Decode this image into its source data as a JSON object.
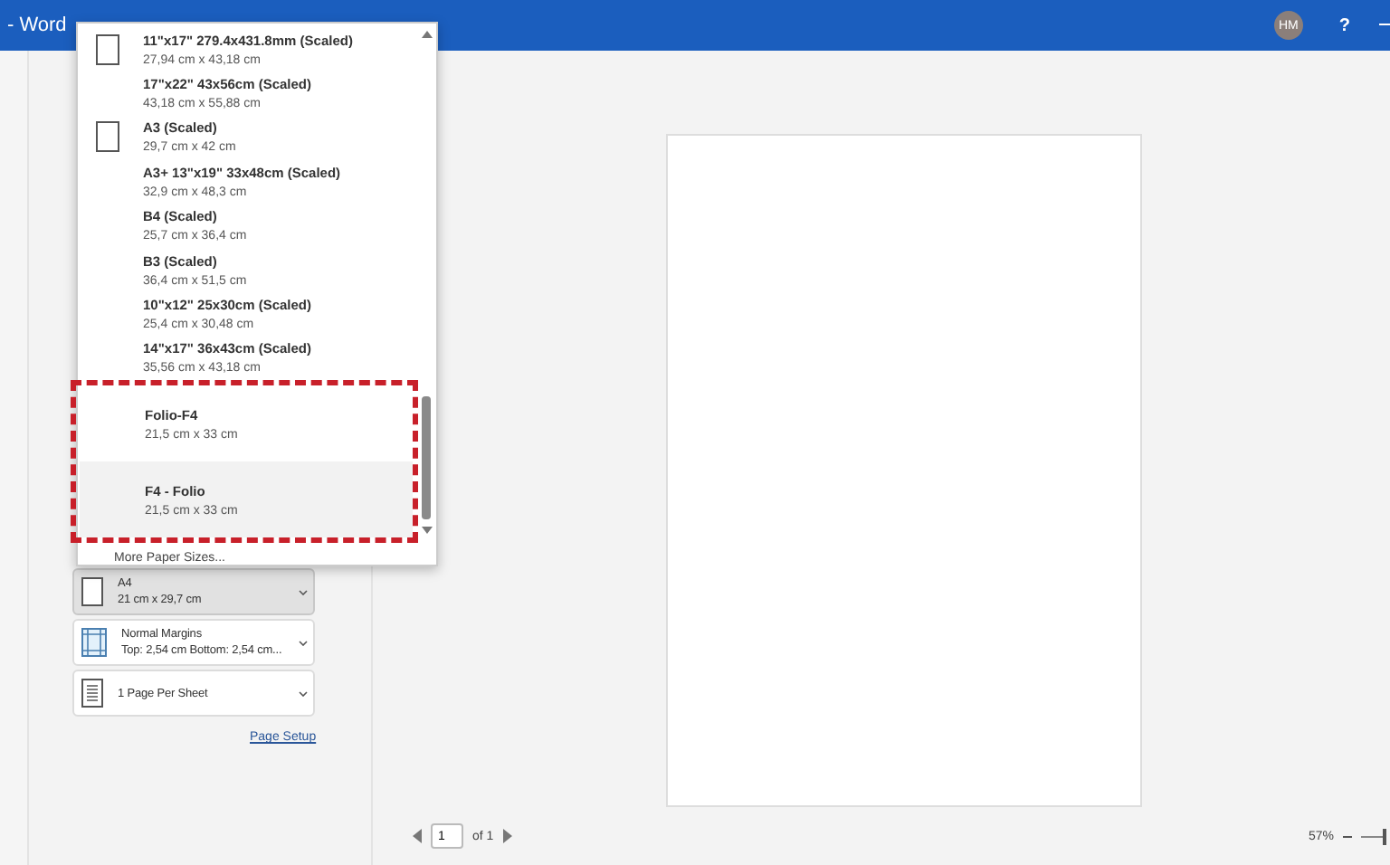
{
  "window": {
    "title": "- Word",
    "avatar": "HM",
    "help": "?"
  },
  "paper_menu": {
    "items": [
      {
        "name": "11\"x17\" 279.4x431.8mm (Scaled)",
        "size": "27,94 cm x 43,18 cm",
        "icon": true,
        "hovered": false,
        "highlighted": false
      },
      {
        "name": "17\"x22\" 43x56cm (Scaled)",
        "size": "43,18 cm x 55,88 cm",
        "icon": false,
        "hovered": false,
        "highlighted": false
      },
      {
        "name": "A3 (Scaled)",
        "size": "29,7 cm x 42 cm",
        "icon": true,
        "hovered": false,
        "highlighted": false
      },
      {
        "name": "A3+ 13\"x19\" 33x48cm (Scaled)",
        "size": "32,9 cm x 48,3 cm",
        "icon": false,
        "hovered": false,
        "highlighted": false
      },
      {
        "name": "B4 (Scaled)",
        "size": "25,7 cm x 36,4 cm",
        "icon": false,
        "hovered": false,
        "highlighted": false
      },
      {
        "name": "B3 (Scaled)",
        "size": "36,4 cm x 51,5 cm",
        "icon": false,
        "hovered": false,
        "highlighted": false
      },
      {
        "name": "10\"x12\" 25x30cm (Scaled)",
        "size": "25,4 cm x 30,48 cm",
        "icon": false,
        "hovered": false,
        "highlighted": false
      },
      {
        "name": "14\"x17\" 36x43cm (Scaled)",
        "size": "35,56 cm x 43,18 cm",
        "icon": false,
        "hovered": false,
        "highlighted": false
      },
      {
        "name": "Folio-F4",
        "size": "21,5 cm x 33 cm",
        "icon": false,
        "hovered": false,
        "highlighted": true
      },
      {
        "name": "F4 - Folio",
        "size": "21,5 cm x 33 cm",
        "icon": false,
        "hovered": true,
        "highlighted": true
      }
    ],
    "more": "More Paper Sizes..."
  },
  "settings": [
    {
      "kind": "paper",
      "title": "A4",
      "detail": "21 cm x 29,7 cm",
      "selected": true
    },
    {
      "kind": "margins",
      "title": "Normal Margins",
      "detail": "Top: 2,54 cm Bottom: 2,54 cm...",
      "selected": false
    },
    {
      "kind": "pages",
      "title": "1 Page Per Sheet",
      "selected": false
    }
  ],
  "page_setup_link": "Page Setup",
  "footer": {
    "page": "1",
    "of": "of 1",
    "zoom": "57%",
    "zoom_slider": {
      "level": 1
    }
  }
}
